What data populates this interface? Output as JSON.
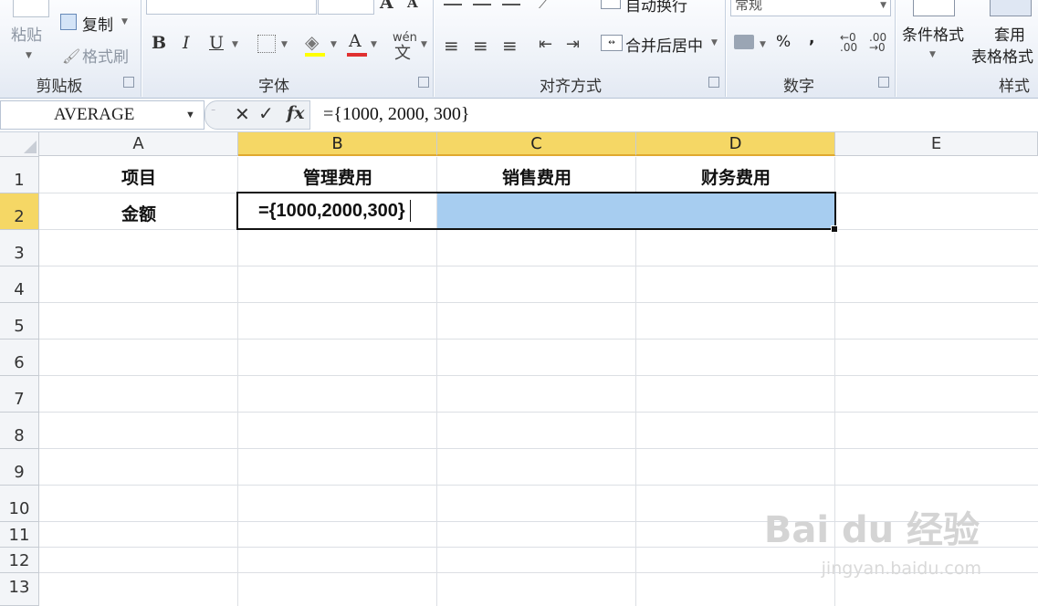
{
  "ribbon": {
    "clipboard": {
      "paste": "粘贴",
      "copy": "复制",
      "format_painter": "格式刷",
      "group_label": "剪贴板"
    },
    "font": {
      "bold": "B",
      "italic": "I",
      "underline": "U",
      "font_color": "A",
      "wen": "wén",
      "group_label": "字体"
    },
    "alignment": {
      "wrap_text": "自动换行",
      "merge_center": "合并后居中",
      "group_label": "对齐方式"
    },
    "number": {
      "format": "常规",
      "percent": "%",
      "comma": ",",
      "group_label": "数字"
    },
    "styles": {
      "conditional_format": "条件格式",
      "table_format_line1": "套用",
      "table_format_line2": "表格格式",
      "group_label": "样式"
    }
  },
  "formula_bar": {
    "name_box": "AVERAGE",
    "fx": "fx",
    "formula": "={1000, 2000, 300}"
  },
  "columns": [
    "A",
    "B",
    "C",
    "D",
    "E"
  ],
  "rows": [
    "1",
    "2",
    "3",
    "4",
    "5",
    "6",
    "7",
    "8",
    "9",
    "10",
    "11",
    "12",
    "13"
  ],
  "cells": {
    "A1": "项目",
    "B1": "管理费用",
    "C1": "销售费用",
    "D1": "财务费用",
    "A2": "金额",
    "B2": "={1000,2000,300}"
  },
  "selection": {
    "range": "B2:D2",
    "highlight_color": "#a7cdf0",
    "header_highlight": "#f5d765"
  },
  "watermark": {
    "logo": "Bai du 经验",
    "url": "jingyan.baidu.com"
  }
}
